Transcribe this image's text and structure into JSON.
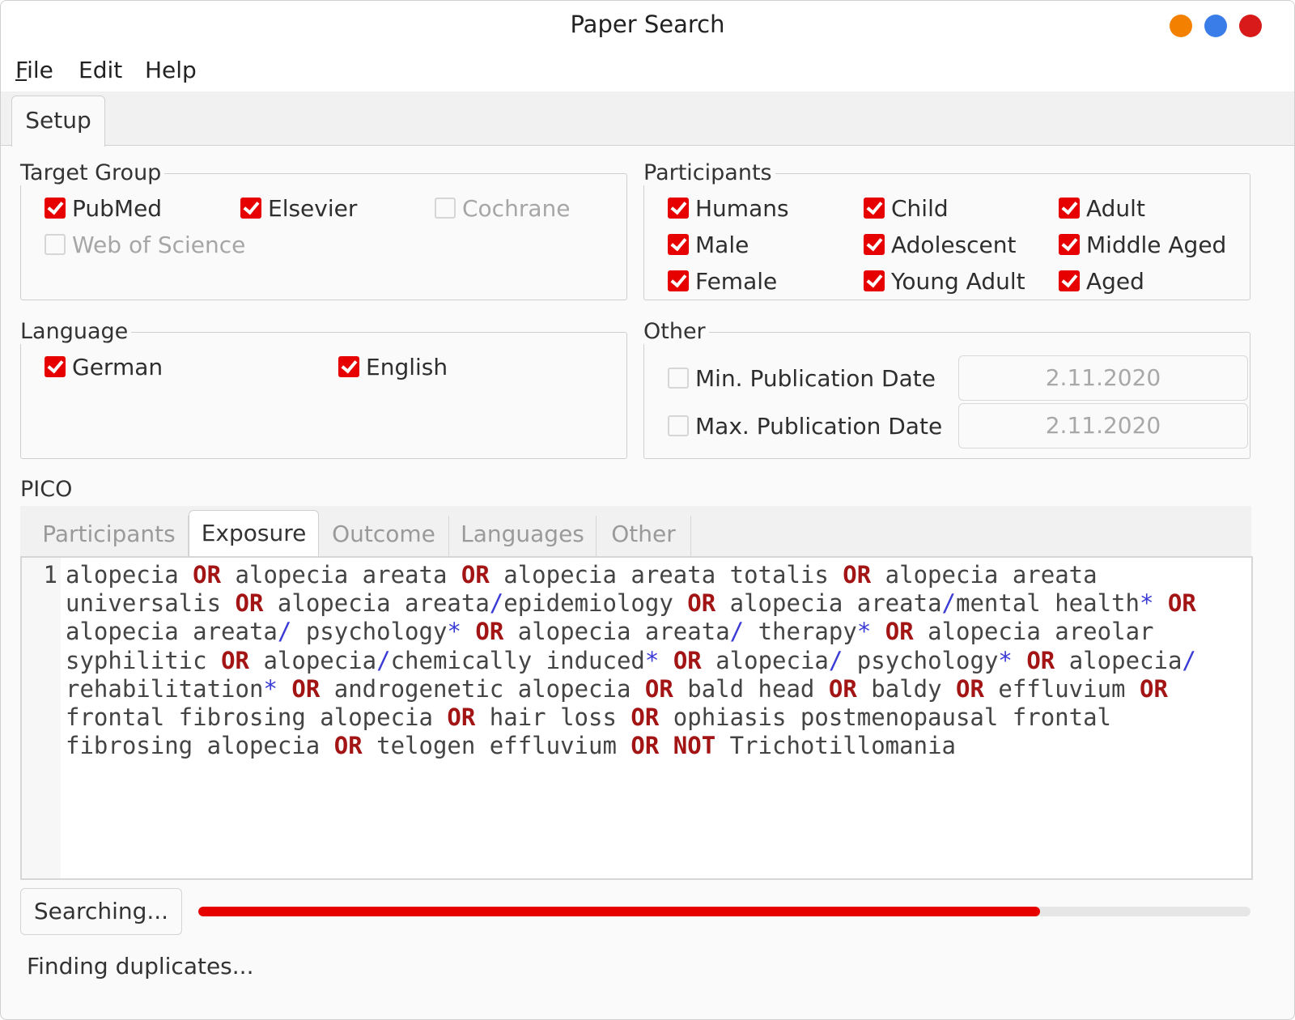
{
  "window": {
    "title": "Paper Search",
    "controls": {
      "minimize_color": "#f48000",
      "maximize_color": "#3b7de8",
      "close_color": "#d81a1a"
    }
  },
  "menu": [
    {
      "mnemonic": "F",
      "rest": "ile"
    },
    {
      "mnemonic": "",
      "rest": "Edit"
    },
    {
      "mnemonic": "",
      "rest": "Help"
    }
  ],
  "main_tab": "Setup",
  "target_group": {
    "label": "Target Group",
    "items": [
      {
        "label": "PubMed",
        "checked": true,
        "enabled": true
      },
      {
        "label": "Elsevier",
        "checked": true,
        "enabled": true
      },
      {
        "label": "Cochrane",
        "checked": false,
        "enabled": false
      },
      {
        "label": "Web of Science",
        "checked": false,
        "enabled": false
      }
    ]
  },
  "participants": {
    "label": "Participants",
    "items": [
      {
        "label": "Humans",
        "checked": true
      },
      {
        "label": "Child",
        "checked": true
      },
      {
        "label": "Adult",
        "checked": true
      },
      {
        "label": "Male",
        "checked": true
      },
      {
        "label": "Adolescent",
        "checked": true
      },
      {
        "label": "Middle Aged",
        "checked": true
      },
      {
        "label": "Female",
        "checked": true
      },
      {
        "label": "Young Adult",
        "checked": true
      },
      {
        "label": "Aged",
        "checked": true
      }
    ]
  },
  "language": {
    "label": "Language",
    "items": [
      {
        "label": "German",
        "checked": true
      },
      {
        "label": "English",
        "checked": true
      }
    ]
  },
  "other": {
    "label": "Other",
    "min_date": {
      "label": "Min. Publication Date",
      "checked": false,
      "value": "2.11.2020"
    },
    "max_date": {
      "label": "Max. Publication Date",
      "checked": false,
      "value": "2.11.2020"
    }
  },
  "pico": {
    "label": "PICO",
    "tabs": [
      "Participants",
      "Exposure",
      "Outcome",
      "Languages",
      "Other"
    ],
    "active_tab": "Exposure",
    "line_number": "1",
    "query": "alopecia OR alopecia areata OR alopecia areata totalis OR alopecia areata universalis OR alopecia areata/epidemiology OR alopecia areata/mental health* OR alopecia areata/ psychology* OR alopecia areata/ therapy* OR alopecia areolar syphilitic OR alopecia/chemically induced* OR alopecia/ psychology* OR alopecia/ rehabilitation* OR androgenetic alopecia OR bald head OR baldy OR effluvium OR frontal fibrosing alopecia OR hair loss OR ophiasis postmenopausal frontal fibrosing alopecia OR telogen effluvium OR NOT Trichotillomania"
  },
  "search_button": "Searching...",
  "progress": {
    "fraction": 0.8
  },
  "status": "Finding duplicates...",
  "colors": {
    "accent": "#e60000",
    "operator": "#a31515",
    "symbol": "#3b3bd6"
  }
}
